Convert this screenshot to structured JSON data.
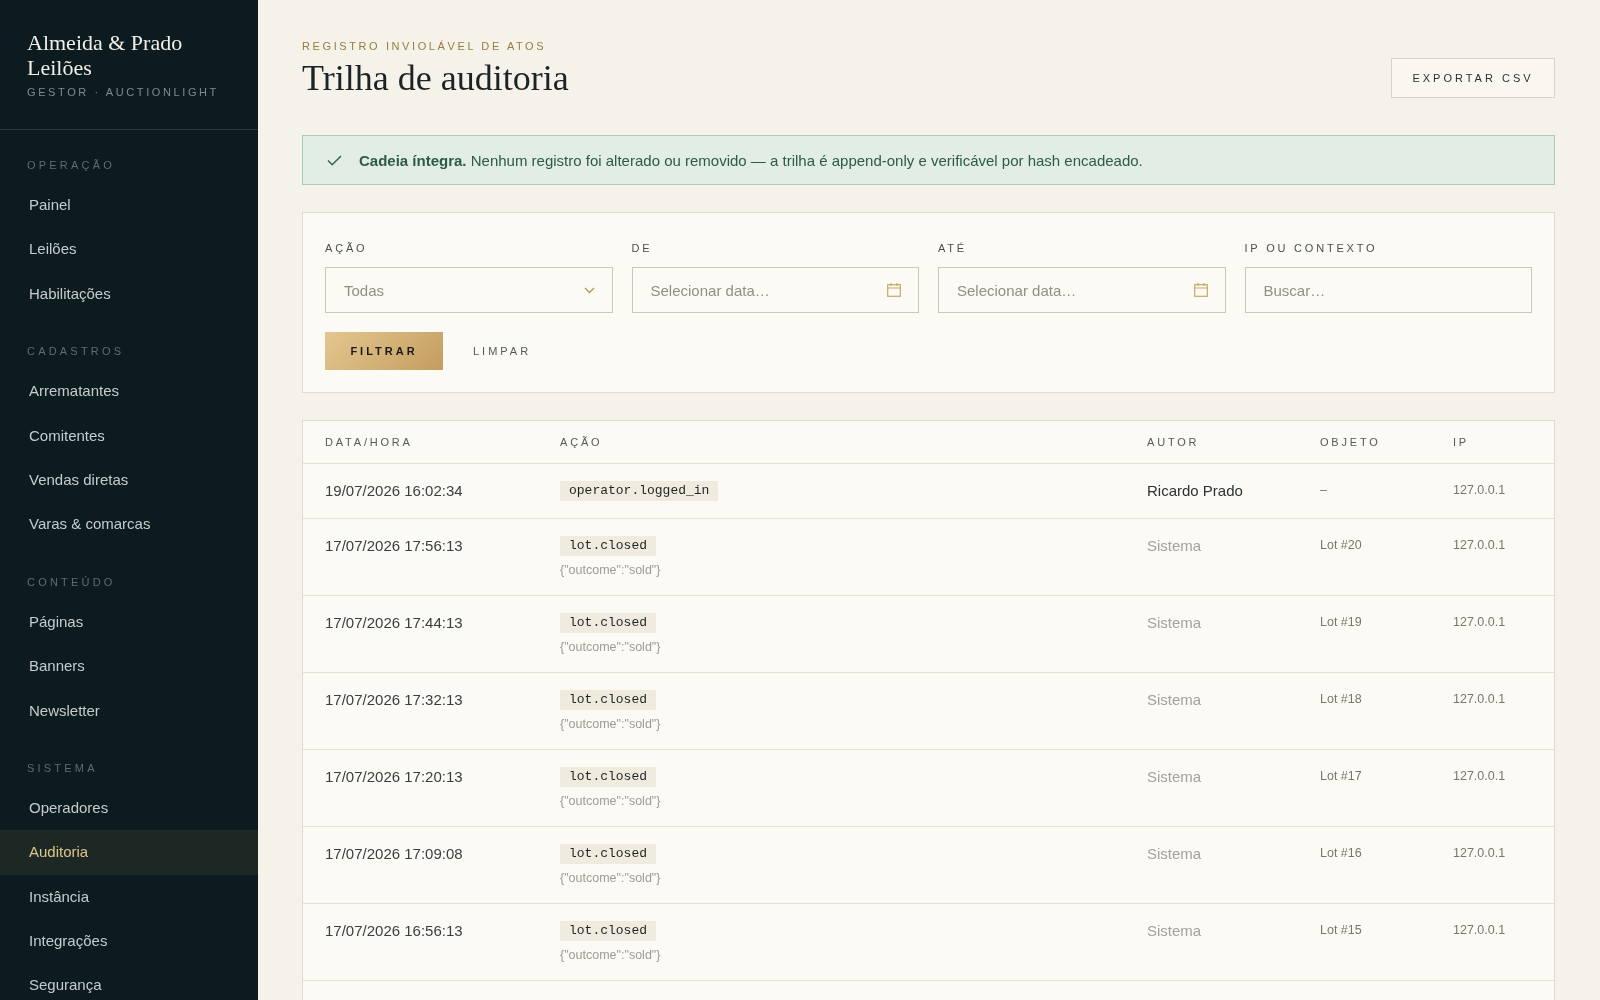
{
  "sidebar": {
    "brand": {
      "title": "Almeida & Prado Leilões",
      "subtitle": "GESTOR · AUCTIONLIGHT"
    },
    "sections": [
      {
        "label": "OPERAÇÃO",
        "items": [
          {
            "label": "Painel",
            "selected": false
          },
          {
            "label": "Leilões",
            "selected": false
          },
          {
            "label": "Habilitações",
            "selected": false
          }
        ]
      },
      {
        "label": "CADASTROS",
        "items": [
          {
            "label": "Arrematantes",
            "selected": false
          },
          {
            "label": "Comitentes",
            "selected": false
          },
          {
            "label": "Vendas diretas",
            "selected": false
          },
          {
            "label": "Varas & comarcas",
            "selected": false
          }
        ]
      },
      {
        "label": "CONTEÚDO",
        "items": [
          {
            "label": "Páginas",
            "selected": false
          },
          {
            "label": "Banners",
            "selected": false
          },
          {
            "label": "Newsletter",
            "selected": false
          }
        ]
      },
      {
        "label": "SISTEMA",
        "items": [
          {
            "label": "Operadores",
            "selected": false
          },
          {
            "label": "Auditoria",
            "selected": true
          },
          {
            "label": "Instância",
            "selected": false
          },
          {
            "label": "Integrações",
            "selected": false
          },
          {
            "label": "Segurança",
            "selected": false
          }
        ]
      }
    ]
  },
  "header": {
    "eyebrow": "REGISTRO INVIOLÁVEL DE ATOS",
    "title": "Trilha de auditoria",
    "export_button": "EXPORTAR CSV"
  },
  "alert": {
    "kind": "success",
    "text": "**Cadeia íntegra.** Nenhum registro foi alterado ou removido — a trilha é append-only e verificável por hash encadeado."
  },
  "filters": {
    "fields": [
      {
        "kind": "select",
        "label": "AÇÃO",
        "value": "Todas"
      },
      {
        "kind": "date",
        "label": "DE",
        "placeholder": "Selecionar data…"
      },
      {
        "kind": "date",
        "label": "ATÉ",
        "placeholder": "Selecionar data…"
      },
      {
        "kind": "text",
        "label": "IP OU CONTEXTO",
        "placeholder": "Buscar…"
      }
    ],
    "buttons": [
      {
        "kind": "primary",
        "label": "FILTRAR"
      },
      {
        "kind": "link",
        "label": "LIMPAR"
      }
    ]
  },
  "table": {
    "columns": [
      "DATA/HORA",
      "AÇÃO",
      "AUTOR",
      "OBJETO",
      "IP"
    ],
    "rows": [
      {
        "kind": "user",
        "datetime": "19/07/2026 16:02:34",
        "action": "operator.logged_in",
        "author": "Ricardo Prado",
        "object": "–",
        "ip": "127.0.0.1"
      },
      {
        "kind": "system",
        "datetime": "17/07/2026 17:56:13",
        "action": "lot.closed",
        "context": "{\"outcome\":\"sold\"}",
        "author": "Sistema",
        "object": "Lot #20",
        "ip": "127.0.0.1"
      },
      {
        "kind": "system",
        "datetime": "17/07/2026 17:44:13",
        "action": "lot.closed",
        "context": "{\"outcome\":\"sold\"}",
        "author": "Sistema",
        "object": "Lot #19",
        "ip": "127.0.0.1"
      },
      {
        "kind": "system",
        "datetime": "17/07/2026 17:32:13",
        "action": "lot.closed",
        "context": "{\"outcome\":\"sold\"}",
        "author": "Sistema",
        "object": "Lot #18",
        "ip": "127.0.0.1"
      },
      {
        "kind": "system",
        "datetime": "17/07/2026 17:20:13",
        "action": "lot.closed",
        "context": "{\"outcome\":\"sold\"}",
        "author": "Sistema",
        "object": "Lot #17",
        "ip": "127.0.0.1"
      },
      {
        "kind": "system",
        "datetime": "17/07/2026 17:09:08",
        "action": "lot.closed",
        "context": "{\"outcome\":\"sold\"}",
        "author": "Sistema",
        "object": "Lot #16",
        "ip": "127.0.0.1"
      },
      {
        "kind": "system",
        "datetime": "17/07/2026 16:56:13",
        "action": "lot.closed",
        "context": "{\"outcome\":\"sold\"}",
        "author": "Sistema",
        "object": "Lot #15",
        "ip": "127.0.0.1"
      }
    ]
  }
}
